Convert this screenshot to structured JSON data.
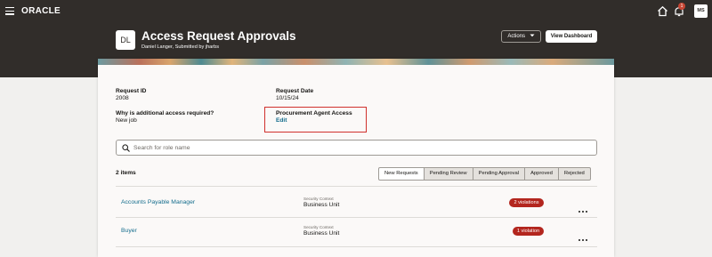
{
  "topbar": {
    "brand": "ORACLE",
    "notification_count": "1",
    "user_initials": "MS"
  },
  "header": {
    "avatar_initials": "DL",
    "title": "Access Request Approvals",
    "subtitle": "Daniel Langer, Submitted by jharbs",
    "actions_label": "Actions",
    "view_dashboard_label": "View Dashboard"
  },
  "details": {
    "request_id_label": "Request ID",
    "request_id_value": "2008",
    "request_date_label": "Request Date",
    "request_date_value": "10/15/24",
    "why_label": "Why is additional access required?",
    "why_value": "New job",
    "procurement_label": "Procurement Agent Access",
    "edit_label": "Edit"
  },
  "search": {
    "placeholder": "Search for role name"
  },
  "list": {
    "count_label": "2 items",
    "tabs": [
      {
        "label": "New Requests"
      },
      {
        "label": "Pending Review"
      },
      {
        "label": "Pending Approval"
      },
      {
        "label": "Approved"
      },
      {
        "label": "Rejected"
      }
    ],
    "rows": [
      {
        "role": "Accounts Payable Manager",
        "ctx_label": "Security Context",
        "ctx_value": "Business Unit",
        "violations": "2 violations"
      },
      {
        "role": "Buyer",
        "ctx_label": "Security Context",
        "ctx_value": "Business Unit",
        "violations": "1 violation"
      }
    ]
  },
  "colors": {
    "header_bg": "#312d2a",
    "link": "#136c8c",
    "violation": "#b3261e",
    "highlight": "#d0312d"
  },
  "icons": [
    "hamburger-menu-icon",
    "home-icon",
    "bell-icon",
    "search-icon",
    "chevron-down-icon",
    "more-options-icon"
  ]
}
